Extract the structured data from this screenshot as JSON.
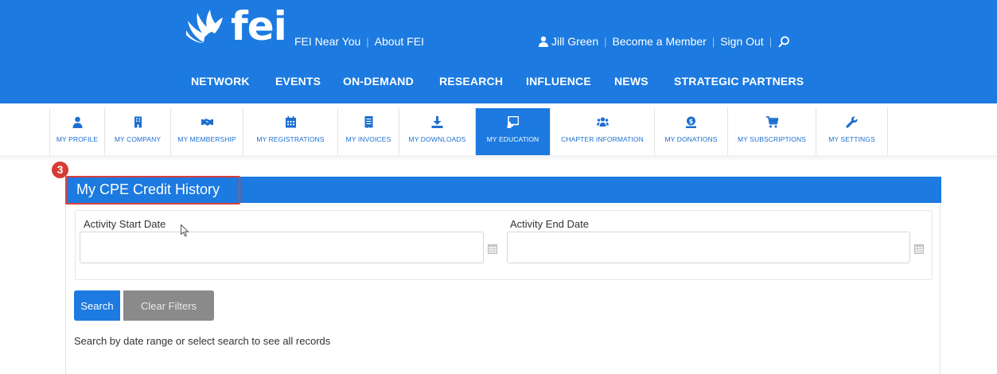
{
  "logo": {
    "text": "fei"
  },
  "top_links": {
    "near_you": "FEI Near You",
    "separator": "|",
    "about": "About FEI"
  },
  "user_links": {
    "user_name": "Jill Green",
    "separator": "|",
    "become_member": "Become a Member",
    "sign_out": "Sign Out"
  },
  "main_nav": [
    "NETWORK",
    "EVENTS",
    "ON-DEMAND",
    "RESEARCH",
    "INFLUENCE",
    "NEWS",
    "STRATEGIC PARTNERS"
  ],
  "tabs": [
    {
      "label": "MY PROFILE",
      "icon": "user-icon"
    },
    {
      "label": "MY COMPANY",
      "icon": "building-icon"
    },
    {
      "label": "MY MEMBERSHIP",
      "icon": "handshake-icon"
    },
    {
      "label": "MY REGISTRATIONS",
      "icon": "calendar-icon"
    },
    {
      "label": "MY INVOICES",
      "icon": "receipt-icon"
    },
    {
      "label": "MY DOWNLOADS",
      "icon": "download-icon"
    },
    {
      "label": "MY EDUCATION",
      "icon": "chalkboard-icon",
      "active": true
    },
    {
      "label": "CHAPTER INFORMATION",
      "icon": "users-icon"
    },
    {
      "label": "MY DONATIONS",
      "icon": "donate-icon"
    },
    {
      "label": "MY SUBSCRIPTIONS",
      "icon": "cart-icon"
    },
    {
      "label": "MY SETTINGS",
      "icon": "wrench-icon"
    }
  ],
  "step_badge": "3",
  "panel": {
    "title": "My CPE Credit History",
    "start_label": "Activity Start Date",
    "start_value": "",
    "end_label": "Activity End Date",
    "end_value": "",
    "search_button": "Search",
    "clear_button": "Clear Filters",
    "hint": "Search by date range or select search to see all records"
  },
  "colors": {
    "brand_blue": "#1c7ae0",
    "tab_text": "#1c6fd0",
    "highlight_red": "#d9403e",
    "clear_gray": "#8a8a8a"
  }
}
